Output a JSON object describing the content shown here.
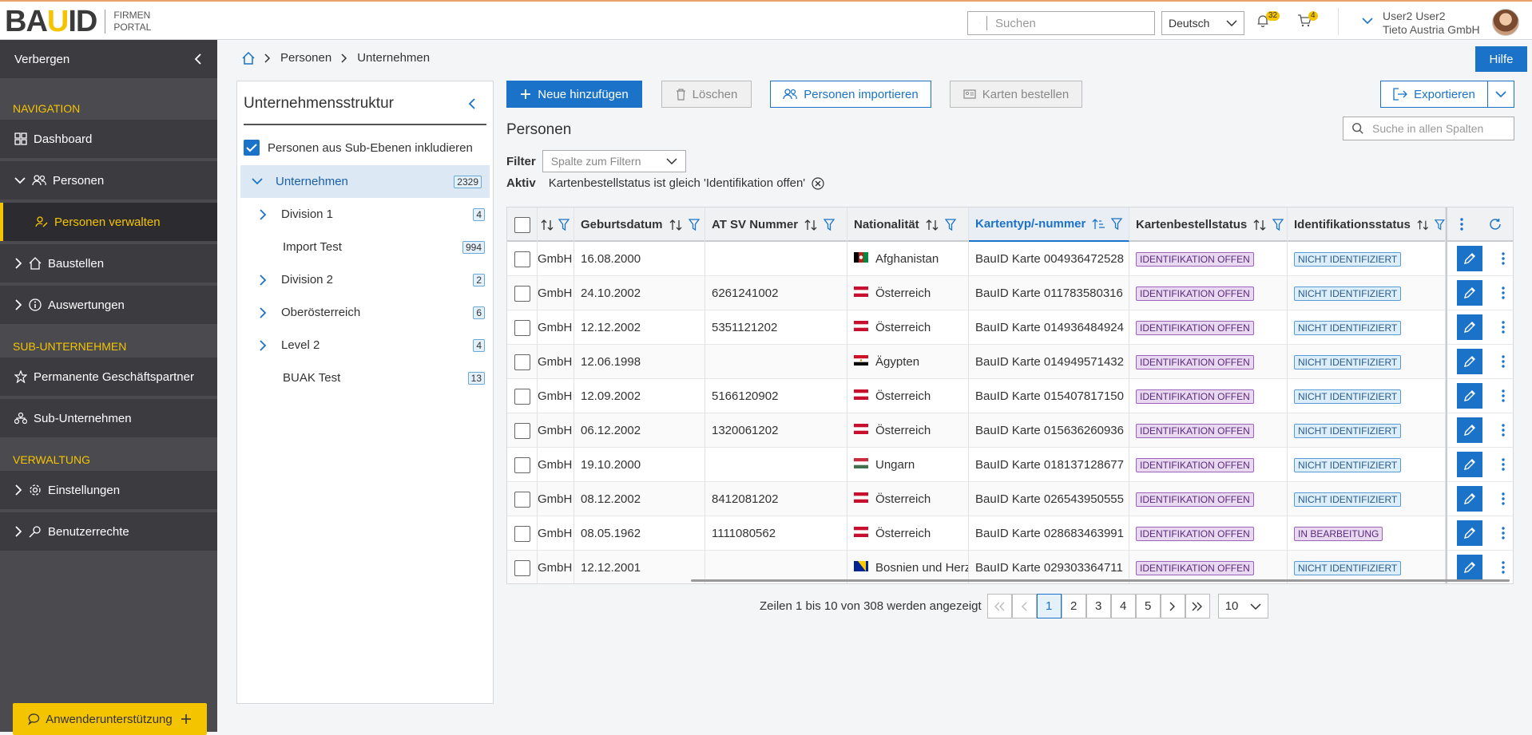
{
  "header": {
    "logo_text": "BAUID",
    "logo_sub1": "FIRMEN",
    "logo_sub2": "PORTAL",
    "search_placeholder": "Suchen",
    "language": "Deutsch",
    "notifications_count": "32",
    "cart_count": "4",
    "user_name": "User2 User2",
    "company": "Tieto Austria GmbH",
    "accent": "#f5c400",
    "primary": "#1a73c8"
  },
  "sidebar": {
    "hide_label": "Verbergen",
    "sections": {
      "navigation": "NAVIGATION",
      "sub": "SUB-UNTERNEHMEN",
      "verwaltung": "VERWALTUNG"
    },
    "items": {
      "dashboard": "Dashboard",
      "personen": "Personen",
      "personen_verwalten": "Personen verwalten",
      "baustellen": "Baustellen",
      "auswertungen": "Auswertungen",
      "geschaeftspartner": "Permanente Geschäftspartner",
      "subunternehmen": "Sub-Unternehmen",
      "einstellungen": "Einstellungen",
      "benutzerrechte": "Benutzerrechte"
    },
    "support": "Anwenderunterstützung"
  },
  "breadcrumb": {
    "a": "Personen",
    "b": "Unternehmen"
  },
  "help": "Hilfe",
  "tree": {
    "title": "Unternehmensstruktur",
    "include_label": "Personen aus Sub-Ebenen inkludieren",
    "nodes": [
      {
        "label": "Unternehmen",
        "count": "2329"
      },
      {
        "label": "Division 1",
        "count": "4"
      },
      {
        "label": "Import Test",
        "count": "994"
      },
      {
        "label": "Division 2",
        "count": "2"
      },
      {
        "label": "Oberösterreich",
        "count": "6"
      },
      {
        "label": "Level 2",
        "count": "4"
      },
      {
        "label": "BUAK Test",
        "count": "13"
      }
    ]
  },
  "toolbar": {
    "add": "Neue hinzufügen",
    "delete": "Löschen",
    "import": "Personen importieren",
    "order_cards": "Karten bestellen",
    "export": "Exportieren"
  },
  "list": {
    "title": "Personen",
    "search_placeholder": "Suche in allen Spalten",
    "filter_label": "Filter",
    "filter_placeholder": "Spalte zum Filtern",
    "active_label": "Aktiv",
    "active_filter": "Kartenbestellstatus ist gleich 'Identifikation offen'"
  },
  "table": {
    "headers": {
      "geburtsdatum": "Geburtsdatum",
      "sv": "AT SV Nummer",
      "nat": "Nationalität",
      "karte": "Kartentyp/-nummer",
      "kbs": "Kartenbestellstatus",
      "ids": "Identifikationsstatus"
    },
    "rows": [
      {
        "firma": "GmbH",
        "geb": "16.08.2000",
        "sv": "",
        "nat": "Afghanistan",
        "flag": "af",
        "karte": "BauID Karte 004936472528",
        "kbs": "IDENTIFIKATION OFFEN",
        "ids": "NICHT IDENTIFIZIERT",
        "ids_type": "blue"
      },
      {
        "firma": "GmbH",
        "geb": "24.10.2002",
        "sv": "6261241002",
        "nat": "Österreich",
        "flag": "at",
        "karte": "BauID Karte 011783580316",
        "kbs": "IDENTIFIKATION OFFEN",
        "ids": "NICHT IDENTIFIZIERT",
        "ids_type": "blue"
      },
      {
        "firma": "GmbH",
        "geb": "12.12.2002",
        "sv": "5351121202",
        "nat": "Österreich",
        "flag": "at",
        "karte": "BauID Karte 014936484924",
        "kbs": "IDENTIFIKATION OFFEN",
        "ids": "NICHT IDENTIFIZIERT",
        "ids_type": "blue"
      },
      {
        "firma": "GmbH",
        "geb": "12.06.1998",
        "sv": "",
        "nat": "Ägypten",
        "flag": "eg",
        "karte": "BauID Karte 014949571432",
        "kbs": "IDENTIFIKATION OFFEN",
        "ids": "NICHT IDENTIFIZIERT",
        "ids_type": "blue"
      },
      {
        "firma": "GmbH",
        "geb": "12.09.2002",
        "sv": "5166120902",
        "nat": "Österreich",
        "flag": "at",
        "karte": "BauID Karte 015407817150",
        "kbs": "IDENTIFIKATION OFFEN",
        "ids": "NICHT IDENTIFIZIERT",
        "ids_type": "blue"
      },
      {
        "firma": "GmbH",
        "geb": "06.12.2002",
        "sv": "1320061202",
        "nat": "Österreich",
        "flag": "at",
        "karte": "BauID Karte 015636260936",
        "kbs": "IDENTIFIKATION OFFEN",
        "ids": "NICHT IDENTIFIZIERT",
        "ids_type": "blue"
      },
      {
        "firma": "GmbH",
        "geb": "19.10.2000",
        "sv": "",
        "nat": "Ungarn",
        "flag": "hu",
        "karte": "BauID Karte 018137128677",
        "kbs": "IDENTIFIKATION OFFEN",
        "ids": "NICHT IDENTIFIZIERT",
        "ids_type": "blue"
      },
      {
        "firma": "GmbH",
        "geb": "08.12.2002",
        "sv": "8412081202",
        "nat": "Österreich",
        "flag": "at",
        "karte": "BauID Karte 026543950555",
        "kbs": "IDENTIFIKATION OFFEN",
        "ids": "NICHT IDENTIFIZIERT",
        "ids_type": "blue"
      },
      {
        "firma": "GmbH",
        "geb": "08.05.1962",
        "sv": "1111080562",
        "nat": "Österreich",
        "flag": "at",
        "karte": "BauID Karte 028683463991",
        "kbs": "IDENTIFIKATION OFFEN",
        "ids": "IN BEARBEITUNG",
        "ids_type": "purple"
      },
      {
        "firma": "GmbH",
        "geb": "12.12.2001",
        "sv": "",
        "nat": "Bosnien und Herz",
        "flag": "ba",
        "karte": "BauID Karte 029303364711",
        "kbs": "IDENTIFIKATION OFFEN",
        "ids": "NICHT IDENTIFIZIERT",
        "ids_type": "blue"
      }
    ]
  },
  "pager": {
    "summary": "Zeilen 1 bis 10 von 308 werden angezeigt",
    "pages": [
      "1",
      "2",
      "3",
      "4",
      "5"
    ],
    "page_size": "10"
  }
}
